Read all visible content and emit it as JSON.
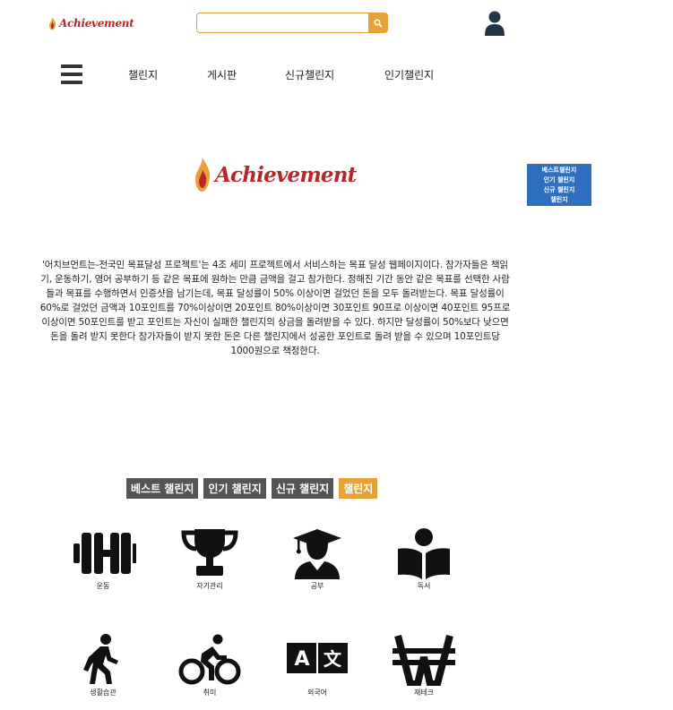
{
  "header": {
    "logo_text": "Achievement",
    "search": {
      "value": "",
      "placeholder": ""
    }
  },
  "nav": {
    "items": [
      "챌린지",
      "게시판",
      "신규챌린지",
      "인기챌린지"
    ]
  },
  "hero": {
    "logo_text": "Achievement"
  },
  "side_menu": {
    "items": [
      "베스트챌린지",
      "인기 챌린지",
      "신규 챌린지",
      "챌린지"
    ]
  },
  "intro": {
    "text": "'어치브먼트는-전국민 목표달성 프로젝트'는 4조 세미 프로젝트에서 서비스하는 목표 달성 웹페이지이다. 참가자들은 책읽기, 운동하기, 영어 공부하기 등 같은 목표에 원하는 만큼 금액을 걸고 참가한다. 정해진 기간 동안 같은 목표를 선택한 사람들과 목표를 수행하면서 인증샷을 남기는데, 목표 달성률이 50% 이상이면 걸었던 돈을 모두 돌려받는다. 목표 달성률이 60%로 걸었던 금액과 10포인트를 70%이상이면 20포인트 80%이상이면 30포인트 90프로 이상이면 40포인트 95프로 이상이면 50포인트를 받고 포인트는 자신이 실패한 챌린지의 상금을 돌려받을 수 있다. 하지만 달성률이 50%보다 낮으면 돈을 돌려 받지 못한다 참가자들이 받지 못한 돈은 다른 챌린지에서 성공한 포인트로 돌려 받을 수 있으며 10포인트당 1000원으로 책정한다."
  },
  "tabs": {
    "items": [
      "베스트 챌린지",
      "인기 챌린지",
      "신규 챌린지",
      "챌린지"
    ],
    "active_index": 3
  },
  "categories": {
    "items": [
      {
        "label": "운동",
        "icon": "dumbbell-icon"
      },
      {
        "label": "자기관리",
        "icon": "trophy-icon"
      },
      {
        "label": "공부",
        "icon": "graduate-icon"
      },
      {
        "label": "독서",
        "icon": "book-reader-icon"
      },
      {
        "label": "생활습관",
        "icon": "walking-icon"
      },
      {
        "label": "취미",
        "icon": "cyclist-icon"
      },
      {
        "label": "외국어",
        "icon": "translate-icon"
      },
      {
        "label": "재테크",
        "icon": "won-icon"
      }
    ]
  },
  "colors": {
    "brand_red": "#b8252a",
    "accent_orange": "#e6a236",
    "tab_gray": "#555555",
    "side_blue": "#2f6fc0"
  }
}
